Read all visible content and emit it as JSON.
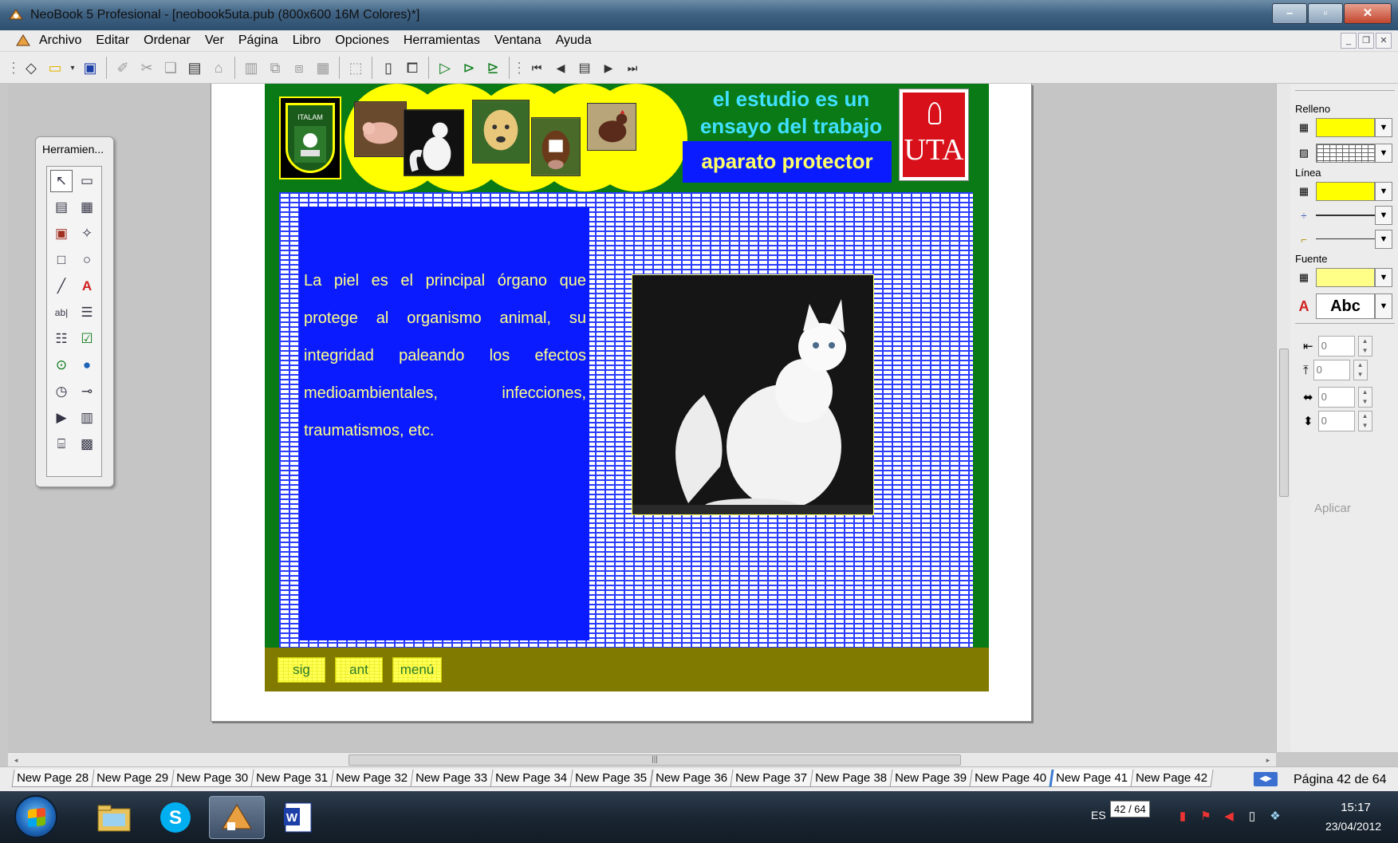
{
  "window": {
    "title": "NeoBook 5 Profesional - [neobook5uta.pub (800x600 16M Colores)*]",
    "controls": [
      "minimize",
      "maximize",
      "close"
    ]
  },
  "menu": {
    "items": [
      "Archivo",
      "Editar",
      "Ordenar",
      "Ver",
      "Página",
      "Libro",
      "Opciones",
      "Herramientas",
      "Ventana",
      "Ayuda"
    ]
  },
  "toolbar": {
    "icons": [
      "eraser-icon",
      "open-folder-icon",
      "save-icon",
      "pencil-icon",
      "cut-icon",
      "copy-icon",
      "paste-icon",
      "format-painter-icon",
      "bring-front-icon",
      "group-icon",
      "ungroup-icon",
      "align-icon",
      "select-all-icon",
      "new-page-icon",
      "pages-icon",
      "run-icon",
      "run-page-icon",
      "run-book-icon",
      "first-page-icon",
      "prev-page-icon",
      "page-list-icon",
      "next-page-icon",
      "last-page-icon"
    ]
  },
  "tools_palette": {
    "title": "Herramien...",
    "tools": [
      "select-arrow-icon",
      "rectangle-select-icon",
      "text-object-icon",
      "text-object2-icon",
      "picture-icon",
      "puzzle-icon",
      "square-icon",
      "circle-icon",
      "line-icon",
      "text-art-icon",
      "textbox-icon",
      "list-box-icon",
      "combo-box-icon",
      "checkbox-icon",
      "radio-icon",
      "globe-icon",
      "timer-icon",
      "slider-icon",
      "media-player-icon",
      "film-strip-icon",
      "clapboard-icon",
      "gallery-icon"
    ]
  },
  "slide": {
    "heading_line1": "el estudio es un",
    "heading_line2": "ensayo del trabajo",
    "title_box": "aparato protector",
    "left_logo_text": "ITALAM",
    "right_logo_text": "UTA",
    "body_text": "La piel es el principal órgano que protege al organismo animal, su integridad paleando los efectos medioambientales, infecciones, traumatismos, etc.",
    "nav_buttons": [
      "sig",
      "ant",
      "menú"
    ],
    "colors": {
      "background": "#0a7a17",
      "panel": "#0a1cff",
      "text": "#ffff88",
      "heading": "#40e0ff",
      "nav_strip": "#807a00"
    }
  },
  "properties": {
    "fill_label": "Relleno",
    "line_label": "Línea",
    "font_label": "Fuente",
    "font_preview": "Abc",
    "spin_values": [
      "0",
      "0",
      "0",
      "0"
    ],
    "apply_label": "Aplicar",
    "fill_color": "#ffff00"
  },
  "page_tabs": {
    "tabs": [
      "New Page 28",
      "New Page 29",
      "New Page 30",
      "New Page 31",
      "New Page 32",
      "New Page 33",
      "New Page 34",
      "New Page 35",
      "New Page 36",
      "New Page 37",
      "New Page 38",
      "New Page 39",
      "New Page 40",
      "New Page 41",
      "New Page 42"
    ],
    "active_tab": "New Page 41",
    "page_count": "Página 42 de 64"
  },
  "taskbar": {
    "language": "ES",
    "badge": "42 / 64",
    "time": "15:17",
    "date": "23/04/2012"
  }
}
